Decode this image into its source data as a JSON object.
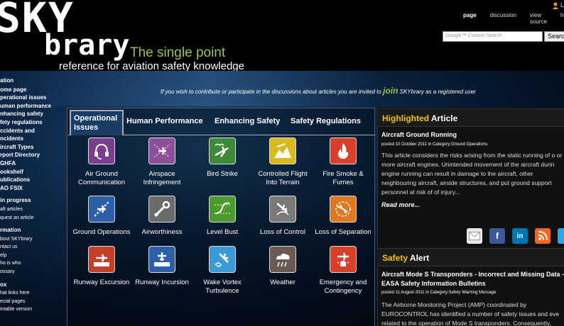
{
  "header": {
    "logo_top": "SKY",
    "logo_bottom": "brary",
    "tagline1": "The single point",
    "tagline2": "reference for aviation safety knowledge",
    "user_text": "L",
    "tabs": [
      "page",
      "discussion",
      "view source",
      "hi"
    ],
    "search_placeholder": "Google™ Custom Search",
    "search_button": "Searc"
  },
  "leftnav": {
    "navigation_title": "ation",
    "navigation_items": [
      "ome page",
      "perational issues",
      "uman performance",
      "nhancing safety",
      "fety regulations",
      "ccidents and",
      "ncidents",
      "ircraft Types",
      "rport Directory",
      "GHFA",
      "ookshelf",
      "ublications",
      "AO FSIX"
    ],
    "progress_title": "in progress",
    "progress_items": [
      "aft articles",
      "quest an article"
    ],
    "info_title": "rmation",
    "info_items": [
      "bout SKYbrary",
      "ntact us",
      "elp",
      "ho is who",
      "ossary"
    ],
    "tools_title": "ox",
    "tools_items": [
      "hat links here",
      "ecial pages",
      "intable version"
    ]
  },
  "contribute": {
    "before": "If you wish to contribute or participate in the discussions about articles you are invited to",
    "join": "join",
    "after": "SKYbrary as a registered user"
  },
  "tabs": {
    "active": "Operational Issues",
    "others": [
      "Human Performance",
      "Enhancing Safety",
      "Safety Regulations"
    ]
  },
  "categories": [
    {
      "label": "Air Ground Communication",
      "icon": "headset-icon",
      "color": "#7b3d8f"
    },
    {
      "label": "Airspace Infringement",
      "icon": "airspace-icon",
      "color": "#8e4f9a"
    },
    {
      "label": "Bird Strike",
      "icon": "bird-strike-icon",
      "color": "#3f8a3a"
    },
    {
      "label": "Controlled Flight Into Terrain",
      "icon": "terrain-icon",
      "color": "#d8b920"
    },
    {
      "label": "Fire Smoke & Fumes",
      "icon": "fire-icon",
      "color": "#d8402a"
    },
    {
      "label": "Ground Operations",
      "icon": "ground-ops-icon",
      "color": "#2d5fa8"
    },
    {
      "label": "Airworthiness",
      "icon": "wrench-icon",
      "color": "#6b6b6b"
    },
    {
      "label": "Level Bust",
      "icon": "level-bust-icon",
      "color": "#4d9a2e"
    },
    {
      "label": "Loss of Control",
      "icon": "loss-control-icon",
      "color": "#7a7a7a"
    },
    {
      "label": "Loss of Separation",
      "icon": "separation-icon",
      "color": "#e07820"
    },
    {
      "label": "Runway Excursion",
      "icon": "runway-excursion-icon",
      "color": "#c2402a"
    },
    {
      "label": "Runway Incursion",
      "icon": "runway-incursion-icon",
      "color": "#2d5fa8"
    },
    {
      "label": "Wake Vortex Turbulence",
      "icon": "wake-vortex-icon",
      "color": "#3a9ad8"
    },
    {
      "label": "Weather",
      "icon": "weather-icon",
      "color": "#6b5a52"
    },
    {
      "label": "Emergency and Contingency",
      "icon": "emergency-icon",
      "color": "#d8402a"
    }
  ],
  "highlighted": {
    "head_yellow": "Highlighted",
    "head_white": "Article",
    "title": "Aircraft Ground Running",
    "posted_prefix": "posted",
    "posted_date": "10 October 2011",
    "posted_category": "in Category:Ground Operations",
    "body": "This article considers the risks arising from the static running of o or more aircraft engines. Unintended movement of the aircraft durin engine running can result in damage to the aircraft, other neighbouring aircraft, airside structures, and put ground support personnel at risk of of injury...",
    "read_more": "Read more..."
  },
  "social": [
    "mail-icon",
    "facebook-icon",
    "linkedin-icon",
    "rss-icon",
    "twitter-icon"
  ],
  "safety_alert": {
    "head_yellow": "Safety",
    "head_white": "Alert",
    "title_line1": "Aircraft Mode S Transponders - Incorrect and Missing Data -",
    "title_line2": "EASA Safety Information Bulletins",
    "posted_prefix": "posted",
    "posted_date": "11 August 2011",
    "posted_category": "in Category:Safety Warning Message",
    "body": "The Airborne Monitoring Project (AMP) coordinated by EUROCONTROL has identified a number of safety issues and eve related to the operation of Mode S transponders. Consequently,"
  }
}
